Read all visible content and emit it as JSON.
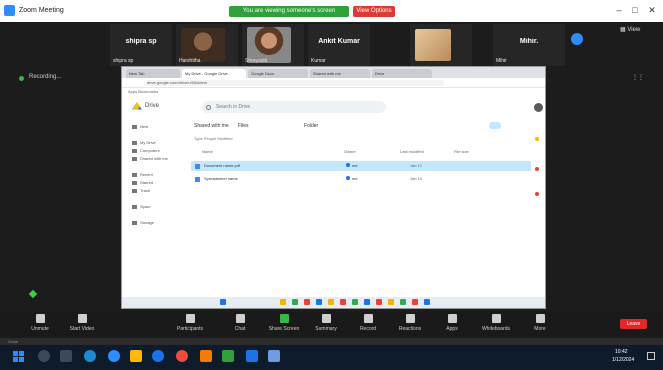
{
  "window": {
    "title": "Zoom Meeting"
  },
  "share": {
    "banner": "You are viewing someone's screen",
    "stop_label": "View Options"
  },
  "participants": [
    {
      "display_name": "shipra sp",
      "label": "shipra sp"
    },
    {
      "display_name": "",
      "label": "Harshitha"
    },
    {
      "display_name": "",
      "label": "Shreyashi"
    },
    {
      "display_name": "Ankit Kumar",
      "label": "Kumar"
    },
    {
      "display_name": "",
      "label": ""
    },
    {
      "display_name": "Mihir.",
      "label": "Mihir"
    }
  ],
  "recording": {
    "label": "Recording..."
  },
  "browser": {
    "tabs": [
      "New Tab",
      "My Drive - Google Drive",
      "Google Docs",
      "Shared with me",
      "Drive"
    ],
    "url": "drive.google.com/drive/u/0/folders",
    "bookmarks": "Apps   Bookmarks"
  },
  "drive": {
    "app_name": "Drive",
    "search_placeholder": "Search in Drive",
    "nav": [
      "New",
      "My Drive",
      "Computers",
      "Shared with me",
      "Recent",
      "Starred",
      "Trash",
      "Spam",
      "Storage"
    ],
    "breadcrumb": [
      "Shared with me",
      "Files",
      "Folder"
    ],
    "filter_row": "Type   People   Modified",
    "columns": [
      "Name",
      "Owner",
      "Last modified",
      "File size"
    ],
    "files": [
      {
        "name": "Document name.pdf",
        "owner": "me",
        "modified": "Jan 12",
        "selected": true
      },
      {
        "name": "Spreadsheet name",
        "owner": "me",
        "modified": "Jan 10",
        "selected": false
      }
    ]
  },
  "toolbar": {
    "items": [
      {
        "label": "Unmute",
        "icon": "microphone-icon"
      },
      {
        "label": "Start Video",
        "icon": "video-icon"
      },
      {
        "label": "Participants",
        "icon": "participants-icon"
      },
      {
        "label": "Chat",
        "icon": "chat-icon"
      },
      {
        "label": "Share Screen",
        "icon": "share-screen-icon"
      },
      {
        "label": "Summary",
        "icon": "summary-icon"
      },
      {
        "label": "Record",
        "icon": "record-icon"
      },
      {
        "label": "Reactions",
        "icon": "reactions-icon"
      },
      {
        "label": "Apps",
        "icon": "apps-icon"
      },
      {
        "label": "Whiteboards",
        "icon": "whiteboard-icon"
      },
      {
        "label": "More",
        "icon": "more-icon"
      }
    ],
    "end_label": "Leave"
  },
  "strip2": "Zoom",
  "clock": {
    "time": "10:42",
    "date": "1/12/2024"
  },
  "colors": {
    "accent": "#2d8cff",
    "end": "#e02828",
    "share_green": "#2fa03a"
  }
}
